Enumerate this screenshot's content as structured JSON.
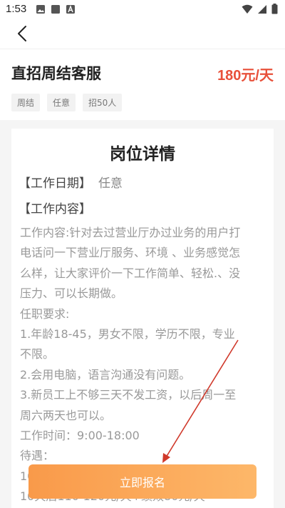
{
  "status_bar": {
    "time": "1:53",
    "icons_left": [
      "image-icon",
      "square-icon",
      "a-notification-icon"
    ],
    "icons_right": [
      "wifi-icon",
      "signal-icon",
      "battery-icon"
    ]
  },
  "nav": {
    "back_icon": "chevron-left-icon"
  },
  "job": {
    "title": "直招周结客服",
    "salary": "180元/天",
    "tags": [
      "周结",
      "任意",
      "招50人"
    ]
  },
  "detail": {
    "heading": "岗位详情",
    "work_date_label": "【工作日期】",
    "work_date_value": "任意",
    "work_content_label": "【工作内容】",
    "description_lines": [
      "工作内容:针对去过营业厅办过业务的用户打",
      "电话问一下营业厅服务、环境 、业务感觉怎",
      "么样，让大家评价一下工作简单、轻松.、没",
      "压力、可以长期做。",
      "任职要求:",
      "1.年龄18-45，男女不限，学历不限，专业",
      "不限。",
      "2.会用电脑，语言沟通没有问题。",
      "3.新员工上不够三天不发工资，以后周一至",
      "周六两天也可以。",
      "工作时间：9:00-18:00",
      "待遇：",
      "10",
      "10天后110-120元/天+绩效80元/天"
    ]
  },
  "apply_button": {
    "label": "立即报名"
  },
  "colors": {
    "salary": "#e8503a",
    "button_gradient_start": "#f99a4a",
    "button_gradient_end": "#fdb769",
    "annotation_arrow": "#d0392b"
  }
}
